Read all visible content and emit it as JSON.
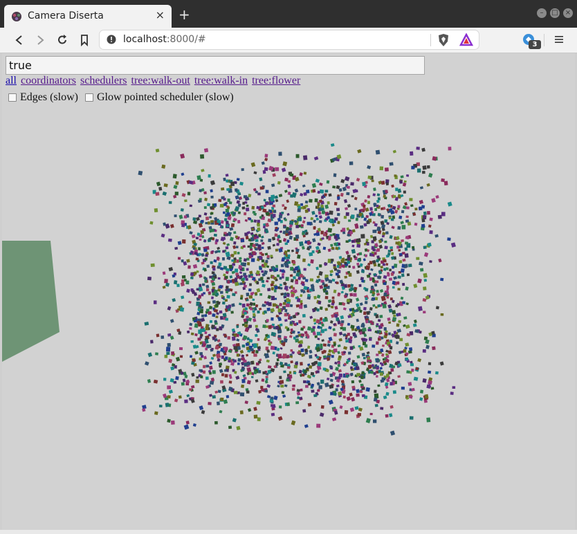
{
  "tab": {
    "title": "Camera Diserta",
    "close_glyph": "×",
    "favicon": "camera-diserta-logo-icon"
  },
  "new_tab_glyph": "+",
  "window_controls": [
    "minimize-icon",
    "maximize-icon",
    "close-icon"
  ],
  "address_bar": {
    "host": "localhost",
    "rest": ":8000/#",
    "info_icon": "info-icon"
  },
  "extensions": {
    "badge_count": "3"
  },
  "page": {
    "query_value": "true",
    "links": [
      "all",
      "coordinators",
      "schedulers",
      "tree:walk-out",
      "tree:walk-in",
      "tree:flower"
    ],
    "options": [
      {
        "label": "Edges (slow)",
        "checked": false
      },
      {
        "label": "Glow pointed scheduler (slow)",
        "checked": false
      }
    ]
  },
  "colors": {
    "canvas_bg": "#d2d2d2",
    "plane": "#6e9475",
    "link": "#551a8b",
    "link_first": "#1a0dab"
  }
}
